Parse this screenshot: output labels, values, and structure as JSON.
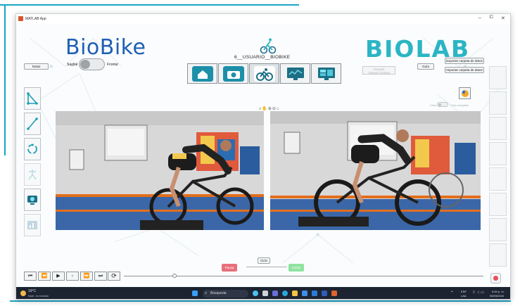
{
  "window": {
    "title": "MATLAB App",
    "minimize": "–",
    "maximize": "⧠",
    "close": "✕"
  },
  "brand": {
    "left_logo": "BioBike",
    "right_logo": "BIOLAB"
  },
  "header": {
    "notes_button": "Notas",
    "view_toggle": {
      "left_label": "Sagital",
      "right_label": "Frontal"
    },
    "user_label": "6__USUARIO__BIOBIKE",
    "tracer_button": "TRAZAR\nTRAYECTORIAS",
    "guide_button": "Guía",
    "export_button": "Exportar carpeta de datos",
    "import_button": "Importar carpeta de datos"
  },
  "nav_icons": [
    "home-icon",
    "camera-icon",
    "cyclist-icon",
    "monitor-chart-icon",
    "monitor-dashboard-icon"
  ],
  "left_tools": [
    "triangle-angle-icon",
    "line-measure-icon",
    "rotate-cycle-icon",
    "skeleton-icon",
    "webcam-icon",
    "chart-report-icon"
  ],
  "analysis_toggle": {
    "left_label": "Ciclo",
    "right_label": "Ciclo completo"
  },
  "playback": {
    "ciclo_button": "Ciclo",
    "pause_button": "Pausa",
    "start_button": "Iniciar",
    "controls": [
      "⏮",
      "⏪",
      "▶",
      "⏸",
      "⏩",
      "⏭",
      "⟳"
    ],
    "progress_fraction": 0.14
  },
  "taskbar": {
    "weather_temp": "19°C",
    "weather_desc": "Nubl. en tránsito",
    "search_placeholder": "Búsqueda",
    "lang_top": "ESP",
    "lang_bottom": "LAA",
    "time": "5:00 p. m.",
    "date": "05/03/2024"
  },
  "colors": {
    "biobike_blue": "#1e5fb4",
    "biolab_teal": "#2bb5c4",
    "accent_line": "#1aa6c4",
    "pause_red": "#e8707a",
    "start_green": "#8fe3a0"
  }
}
